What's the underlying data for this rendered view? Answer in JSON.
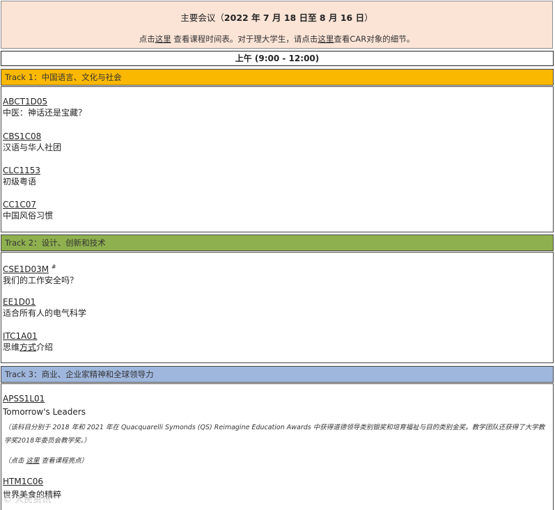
{
  "banner": {
    "title_prefix": "主要会议（",
    "title_dates": "2022 年 7 月 18 日至 8 月 16 日",
    "title_suffix": "）",
    "sub_part1": "点击",
    "sub_link1": "这里",
    "sub_part2": " 查看课程时间表。对于理大学生，请点击",
    "sub_link2": "这里",
    "sub_part3": "查看CAR对象的细节。"
  },
  "session": {
    "label": "上午 (9:00 - 12:00)"
  },
  "tracks": [
    {
      "label": "Track 1：中国语言、文化与社会",
      "color": "#fbb800",
      "courses": [
        {
          "code": "ABCT1D05",
          "name": "中医：神话还是宝藏？"
        },
        {
          "code": "CBS1C08",
          "name": "汉语与华人社团"
        },
        {
          "code": "CLC1153",
          "name": "初级粤语"
        },
        {
          "code": "CC1C07",
          "name": "中国风俗习惯"
        }
      ]
    },
    {
      "label": "Track 2：设计、创新和技术",
      "color": "#8fb04f",
      "courses": [
        {
          "code": "CSE1D03M",
          "mark": "#",
          "name": "我们的工作安全吗？"
        },
        {
          "code": "EE1D01",
          "name": "适合所有人的电气科学"
        },
        {
          "code": "ITC1A01",
          "name_pre": "思维",
          "name_link": "方式",
          "name_post": "介绍"
        }
      ]
    },
    {
      "label": "Track 3：商业、企业家精神和全球领导力",
      "color": "#9fb7dd",
      "courses": [
        {
          "code": "APSS1L01",
          "name": "Tomorrow's Leaders"
        },
        {
          "code": "HTM1C06",
          "name": "世界美食的精粹"
        }
      ],
      "note": "（该科目分别于 2018 年和 2021 年在 Quacquarelli Symonds (QS) Reimagine Education Awards 中获得道德领导类别银奖和培育福祉与目的类别金奖。教学团队还获得了大学教学奖2018年委员会教学奖。）",
      "note_link_pre": "（点击 ",
      "note_link": "这里",
      "note_link_post": " 查看课程亮点）"
    }
  ],
  "watermark": "© 人民资讯"
}
